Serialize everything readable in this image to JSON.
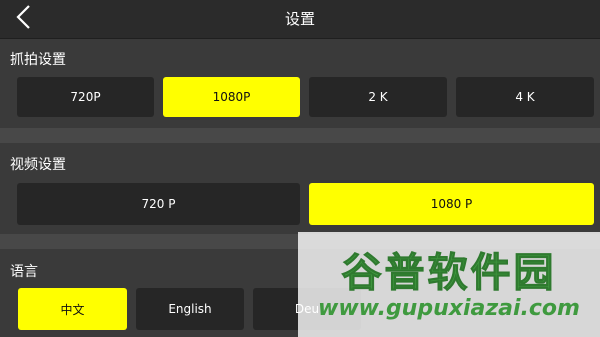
{
  "header": {
    "title": "设置",
    "back_icon": "chevron-left-icon"
  },
  "capture": {
    "label": "抓拍设置",
    "options": [
      "720P",
      "1080P",
      "2 K",
      "4 K"
    ],
    "selected": "1080P"
  },
  "video": {
    "label": "视频设置",
    "options": [
      "720 P",
      "1080 P"
    ],
    "selected": "1080 P"
  },
  "language": {
    "label": "语言",
    "options": [
      "中文",
      "English",
      "Deu"
    ],
    "selected": "中文"
  },
  "watermark": {
    "title": "谷普软件园",
    "url": "www.gupuxiazai.com"
  },
  "colors": {
    "accent": "#ffff00",
    "button": "#262626",
    "background": "#3a3a3a"
  }
}
